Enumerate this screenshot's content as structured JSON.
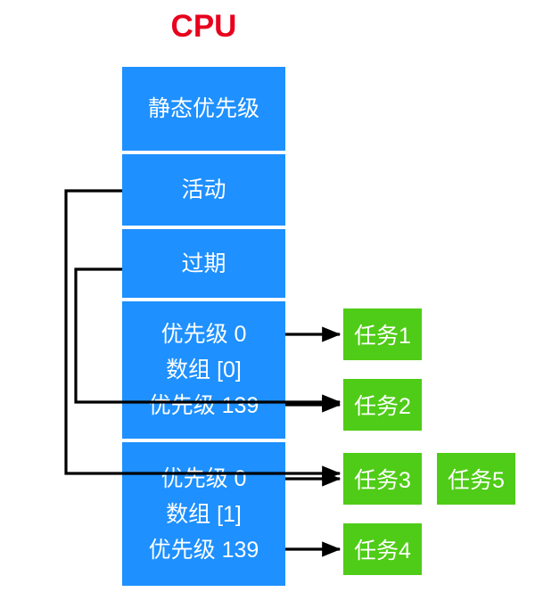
{
  "diagram": {
    "title": "CPU",
    "title_color": "#e8001c",
    "colors": {
      "runqueue_fill": "#1e90ff",
      "task_fill": "#4fcc17",
      "connector": "#000000",
      "background": "#ffffff",
      "cell_text": "#ffffff"
    },
    "runqueue": {
      "name": "cpu-runqueue-column",
      "cells": [
        {
          "id": "static-priority",
          "lines": [
            "静态优先级"
          ]
        },
        {
          "id": "active",
          "lines": [
            "活动"
          ]
        },
        {
          "id": "expired",
          "lines": [
            "过期"
          ]
        },
        {
          "id": "array-0",
          "lines": [
            "优先级 0",
            "数组 [0]",
            "优先级 139"
          ]
        },
        {
          "id": "array-1",
          "lines": [
            "优先级 0",
            "数组 [1]",
            "优先级 139"
          ]
        }
      ]
    },
    "tasks": [
      {
        "id": "task-1",
        "label": "任务1"
      },
      {
        "id": "task-2",
        "label": "任务2"
      },
      {
        "id": "task-3",
        "label": "任务3"
      },
      {
        "id": "task-4",
        "label": "任务4"
      },
      {
        "id": "task-5",
        "label": "任务5"
      }
    ],
    "connections": [
      {
        "id": "active-to-array1",
        "from": "活动",
        "to": "数组 [1] 优先级 0",
        "style": "elbow-left"
      },
      {
        "id": "expired-to-array0",
        "from": "过期",
        "to": "数组 [0] 优先级 139",
        "style": "elbow-left"
      },
      {
        "id": "array0-prio0-to-task1",
        "from": "优先级 0",
        "to": "任务1",
        "style": "straight-right"
      },
      {
        "id": "array0-prio139-to-task2",
        "from": "优先级 139",
        "to": "任务2",
        "style": "straight-right"
      },
      {
        "id": "array1-prio0-to-task3",
        "from": "优先级 0",
        "to": "任务3",
        "style": "straight-right"
      },
      {
        "id": "array1-prio139-to-task4",
        "from": "优先级 139",
        "to": "任务4",
        "style": "straight-right"
      }
    ]
  }
}
